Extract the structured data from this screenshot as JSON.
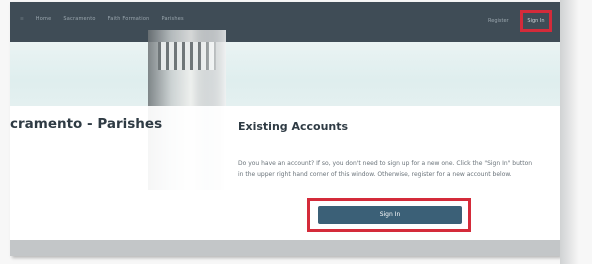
{
  "nav": {
    "links": [
      "☰",
      "Home",
      "Sacramento",
      "Faith Formation",
      "Parishes"
    ],
    "register_label": "Register",
    "signin_label": "Sign In"
  },
  "left_panel": {
    "title": "cramento - Parishes"
  },
  "existing_accounts": {
    "title": "Existing Accounts",
    "body": "Do you have an account? If so, you don't need to sign up for a new one. Click the \"Sign In\" button in the upper right hand corner of this window. Otherwise, register for a new account below.",
    "button_label": "Sign In"
  },
  "colors": {
    "nav_background": "#3f4c56",
    "highlight": "#d42b3a",
    "button": "#3b6077"
  }
}
